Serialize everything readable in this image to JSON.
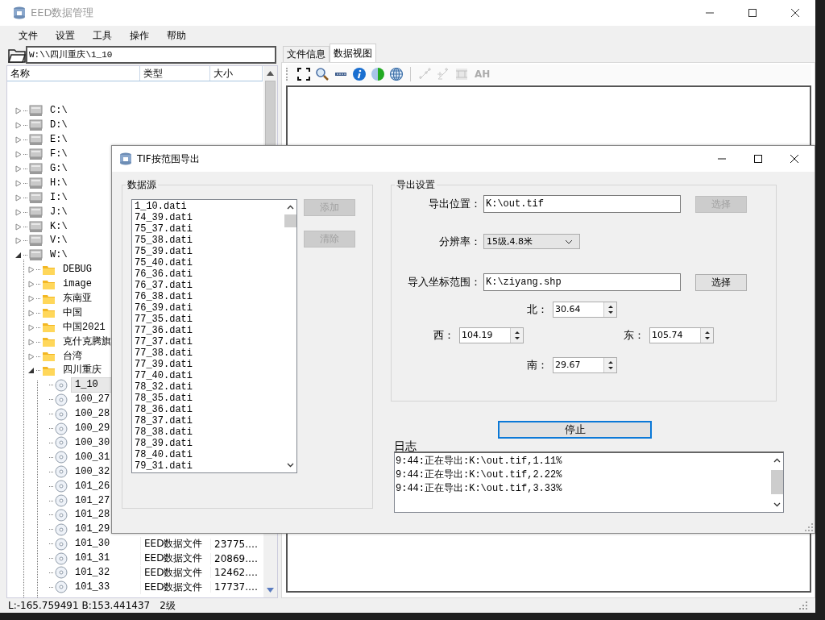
{
  "window": {
    "title": "EED数据管理"
  },
  "menu": [
    "文件",
    "设置",
    "工具",
    "操作",
    "帮助"
  ],
  "path": "W:\\\\四川重庆\\1_10",
  "tree": {
    "columns": [
      "名称",
      "类型",
      "大小"
    ],
    "items": [
      {
        "name": "C:\\",
        "kind": "drive",
        "expanded": false,
        "selected": false
      },
      {
        "name": "D:\\",
        "kind": "drive",
        "expanded": false,
        "selected": false
      },
      {
        "name": "E:\\",
        "kind": "drive",
        "expanded": false,
        "selected": false
      },
      {
        "name": "F:\\",
        "kind": "drive",
        "expanded": false,
        "selected": false
      },
      {
        "name": "G:\\",
        "kind": "drive",
        "expanded": false,
        "selected": false
      },
      {
        "name": "H:\\",
        "kind": "drive",
        "expanded": false,
        "selected": false
      },
      {
        "name": "I:\\",
        "kind": "drive",
        "expanded": false,
        "selected": false
      },
      {
        "name": "J:\\",
        "kind": "drive",
        "expanded": false,
        "selected": false
      },
      {
        "name": "K:\\",
        "kind": "drive",
        "expanded": false,
        "selected": false
      },
      {
        "name": "V:\\",
        "kind": "drive",
        "expanded": false,
        "selected": false
      },
      {
        "name": "W:\\",
        "kind": "drive",
        "expanded": true,
        "selected": false,
        "children": [
          {
            "name": "DEBUG",
            "kind": "folder",
            "expanded": false,
            "selected": false
          },
          {
            "name": "image",
            "kind": "folder",
            "expanded": false,
            "selected": false
          },
          {
            "name": "东南亚",
            "kind": "folder",
            "expanded": false,
            "selected": false
          },
          {
            "name": "中国",
            "kind": "folder",
            "expanded": false,
            "selected": false
          },
          {
            "name": "中国2021",
            "kind": "folder",
            "expanded": false,
            "selected": false
          },
          {
            "name": "克什克腾旗",
            "kind": "folder",
            "expanded": false,
            "selected": false
          },
          {
            "name": "台湾",
            "kind": "folder",
            "expanded": false,
            "selected": false
          },
          {
            "name": "四川重庆",
            "kind": "folder",
            "expanded": true,
            "selected": false,
            "children": [
              {
                "name": "1_10",
                "kind": "file",
                "selected": true
              },
              {
                "name": "100_27",
                "kind": "file",
                "selected": false
              },
              {
                "name": "100_28",
                "kind": "file",
                "selected": false
              },
              {
                "name": "100_29",
                "kind": "file",
                "selected": false
              },
              {
                "name": "100_30",
                "kind": "file",
                "selected": false
              },
              {
                "name": "100_31",
                "kind": "file",
                "selected": false
              },
              {
                "name": "100_32",
                "kind": "file",
                "selected": false
              },
              {
                "name": "101_26",
                "kind": "file",
                "selected": false
              },
              {
                "name": "101_27",
                "kind": "file",
                "selected": false
              },
              {
                "name": "101_28",
                "kind": "file",
                "selected": false
              },
              {
                "name": "101_29",
                "kind": "file",
                "selected": false
              },
              {
                "name": "101_30",
                "kind": "file",
                "selected": false,
                "type": "EED数据文件",
                "size": "23775.…"
              },
              {
                "name": "101_31",
                "kind": "file",
                "selected": false,
                "type": "EED数据文件",
                "size": "20869.…"
              },
              {
                "name": "101_32",
                "kind": "file",
                "selected": false,
                "type": "EED数据文件",
                "size": "12462.…"
              },
              {
                "name": "101_33",
                "kind": "file",
                "selected": false,
                "type": "EED数据文件",
                "size": "17737.…"
              }
            ]
          }
        ]
      }
    ]
  },
  "tabs": [
    {
      "label": "文件信息",
      "selected": false
    },
    {
      "label": "数据视图",
      "selected": true
    }
  ],
  "toolbar": [
    {
      "kind": "fit",
      "disabled": false
    },
    {
      "kind": "zoom",
      "disabled": false
    },
    {
      "kind": "ruler",
      "disabled": false
    },
    {
      "kind": "info",
      "disabled": false
    },
    {
      "kind": "contrast",
      "disabled": false
    },
    {
      "kind": "globe",
      "disabled": false
    },
    {
      "kind": "separator"
    },
    {
      "kind": "add-point",
      "disabled": true
    },
    {
      "kind": "remove-point",
      "disabled": true
    },
    {
      "kind": "grid",
      "disabled": true
    },
    {
      "kind": "text",
      "label": "AH",
      "disabled": true
    }
  ],
  "status_bar": {
    "coords": "L:-165.759491 B:153.441437",
    "grade": "2级"
  },
  "dialog": {
    "title": "TIF按范围导出",
    "source": {
      "label": "数据源",
      "files": [
        "1_10.dati",
        "74_39.dati",
        "75_37.dati",
        "75_38.dati",
        "75_39.dati",
        "75_40.dati",
        "76_36.dati",
        "76_37.dati",
        "76_38.dati",
        "76_39.dati",
        "77_35.dati",
        "77_36.dati",
        "77_37.dati",
        "77_38.dati",
        "77_39.dati",
        "77_40.dati",
        "78_32.dati",
        "78_35.dati",
        "78_36.dati",
        "78_37.dati",
        "78_38.dati",
        "78_39.dati",
        "78_40.dati",
        "79_31.dati"
      ],
      "buttons": [
        {
          "label": "添加",
          "disabled": true
        },
        {
          "label": "清除",
          "disabled": true
        }
      ]
    },
    "settings": {
      "label": "导出设置",
      "output": {
        "label": "导出位置：",
        "value": "K:\\out.tif",
        "button": {
          "label": "选择",
          "disabled": true
        }
      },
      "resolution": {
        "label": "分辨率：",
        "value": "15级,4.8米"
      },
      "extent": {
        "label": "导入坐标范围：",
        "value": "K:\\ziyang.shp",
        "button": {
          "label": "选择",
          "disabled": false
        }
      },
      "north": {
        "label": "北：",
        "value": "30.64"
      },
      "west": {
        "label": "西：",
        "value": "104.19"
      },
      "east": {
        "label": "东：",
        "value": "105.74"
      },
      "south": {
        "label": "南：",
        "value": "29.67"
      }
    },
    "stop_button": {
      "label": "停止",
      "focused": true
    },
    "log": {
      "label": "日志",
      "lines": [
        "9:44:正在导出:K:\\out.tif,1.11%",
        "9:44:正在导出:K:\\out.tif,2.22%",
        "9:44:正在导出:K:\\out.tif,3.33%"
      ]
    }
  }
}
